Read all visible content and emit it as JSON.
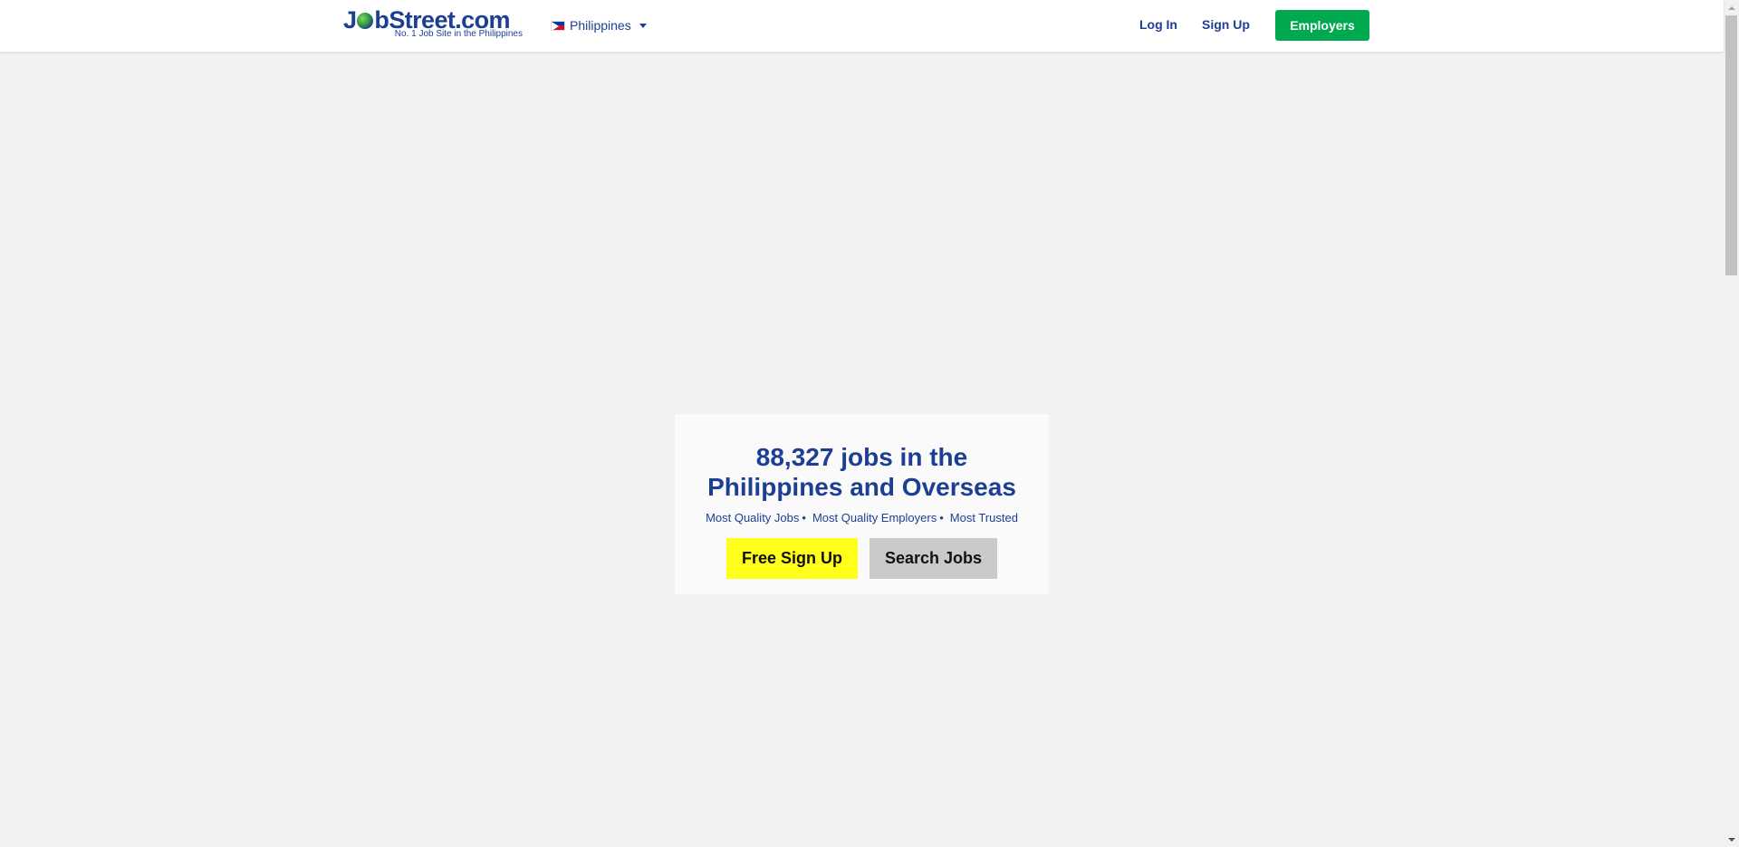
{
  "header": {
    "logo": {
      "name": "JobStreet.com",
      "tagline": "No. 1 Job Site in the Philippines"
    },
    "country_selector": {
      "flag_icon": "philippines-flag-icon",
      "label": "Philippines",
      "caret_icon": "caret-down-icon"
    },
    "nav": {
      "login_label": "Log In",
      "signup_label": "Sign Up",
      "employers_label": "Employers"
    },
    "colors": {
      "brand_blue": "#1c3f94",
      "employers_green": "#00a84f"
    }
  },
  "hero": {
    "title_line1": "88,327 jobs in the",
    "title_line2": "Philippines and Overseas",
    "taglines": [
      "Most Quality Jobs",
      "Most Quality Employers",
      "Most Trusted"
    ],
    "separator": "•",
    "signup_button": "Free Sign Up",
    "search_button": "Search Jobs",
    "colors": {
      "signup_bg": "#ffff1a",
      "search_bg": "#c9c9c9"
    }
  }
}
